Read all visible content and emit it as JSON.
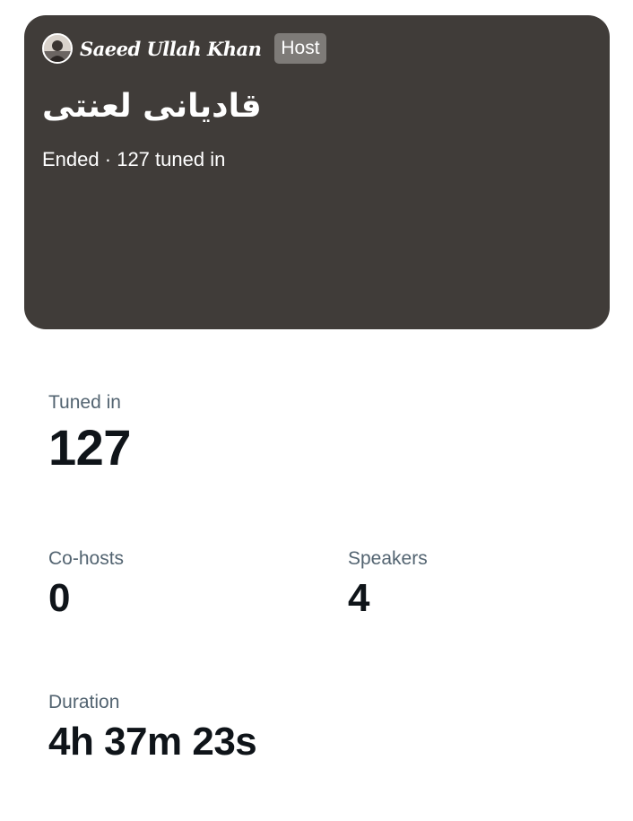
{
  "space": {
    "host_name": "Saeed Ullah Khan",
    "host_badge": "Host",
    "title": "قادیانی لعنتی",
    "status": "Ended",
    "separator": "·",
    "tuned_in_text": "127 tuned in",
    "card_color": "#403c39"
  },
  "stats": {
    "tuned_in": {
      "label": "Tuned in",
      "value": "127"
    },
    "cohosts": {
      "label": "Co-hosts",
      "value": "0"
    },
    "speakers": {
      "label": "Speakers",
      "value": "4"
    },
    "duration": {
      "label": "Duration",
      "value": "4h 37m 23s"
    }
  },
  "icons": {
    "avatar": "user-avatar"
  }
}
